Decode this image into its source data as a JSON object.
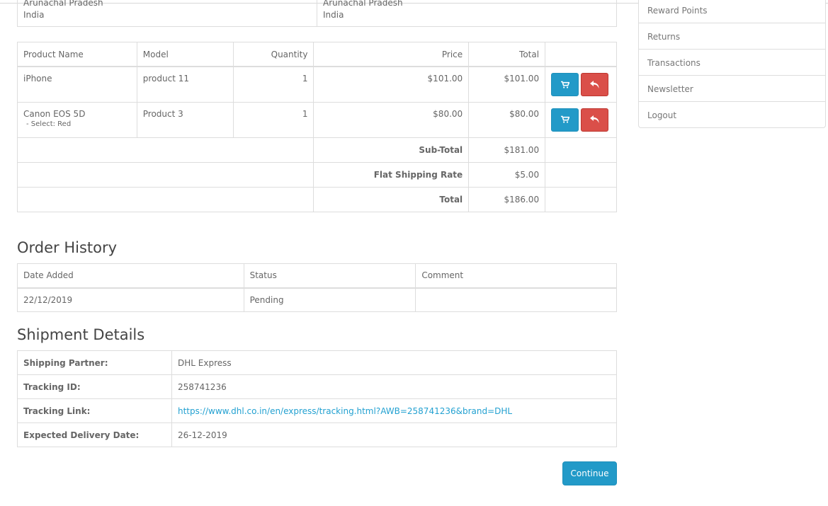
{
  "addresses": [
    {
      "state": "Arunachal Pradesh",
      "country": "India"
    },
    {
      "state": "Arunachal Pradesh",
      "country": "India"
    }
  ],
  "products": {
    "headers": {
      "name": "Product Name",
      "model": "Model",
      "quantity": "Quantity",
      "price": "Price",
      "total": "Total"
    },
    "rows": [
      {
        "name": "iPhone",
        "option": "",
        "model": "product 11",
        "quantity": "1",
        "price": "$101.00",
        "total": "$101.00"
      },
      {
        "name": "Canon EOS 5D",
        "option": "- Select: Red",
        "model": "Product 3",
        "quantity": "1",
        "price": "$80.00",
        "total": "$80.00"
      }
    ],
    "totals": [
      {
        "label": "Sub-Total",
        "value": "$181.00"
      },
      {
        "label": "Flat Shipping Rate",
        "value": "$5.00"
      },
      {
        "label": "Total",
        "value": "$186.00"
      }
    ],
    "actions": {
      "reorder_icon": "cart-icon",
      "return_icon": "reply-icon",
      "reorder_color": "#229ac8",
      "return_color": "#da4f49"
    }
  },
  "order_history": {
    "title": "Order History",
    "headers": {
      "date": "Date Added",
      "status": "Status",
      "comment": "Comment"
    },
    "rows": [
      {
        "date": "22/12/2019",
        "status": "Pending",
        "comment": ""
      }
    ]
  },
  "shipment": {
    "title": "Shipment Details",
    "rows": [
      {
        "label": "Shipping Partner:",
        "value": "DHL Express"
      },
      {
        "label": "Tracking ID:",
        "value": "258741236"
      },
      {
        "label": "Tracking Link:",
        "value": "https://www.dhl.co.in/en/express/tracking.html?AWB=258741236&brand=DHL"
      },
      {
        "label": "Expected Delivery Date:",
        "value": "26-12-2019"
      }
    ]
  },
  "continue_label": "Continue",
  "account_menu": [
    "Reward Points",
    "Returns",
    "Transactions",
    "Newsletter",
    "Logout"
  ]
}
